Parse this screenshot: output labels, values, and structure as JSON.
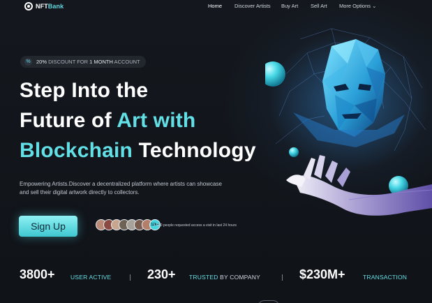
{
  "header": {
    "logo": {
      "text_main": "NFT",
      "text_accent": "Bank"
    },
    "nav": [
      {
        "label": "Home",
        "active": true
      },
      {
        "label": "Discover Artists",
        "active": false
      },
      {
        "label": "Buy Art",
        "active": false
      },
      {
        "label": "Sell Art",
        "active": false
      },
      {
        "label": "More Options ⌄",
        "active": false
      }
    ]
  },
  "hero": {
    "discount": {
      "icon": "percent-icon",
      "prefix": "20% ",
      "mid": "DISCOUNT FOR ",
      "months": "1 MONTH",
      "suffix": " ACCOUNT"
    },
    "headline": {
      "line1": "Step Into the",
      "line2_plain": "Future of ",
      "line2_accent": "Art with",
      "line3_accent": "Blockchain",
      "line3_plain": " Technology"
    },
    "description": "Empowering Artists.Discover a decentralized platform where artists can showcase and sell their digital artwork directly to collectors.",
    "signup_label": "Sign Up",
    "avatars_more": "12k+",
    "requests_text": "1.600 people requested access a visit in last 24 hours"
  },
  "stats": [
    {
      "value": "3800+",
      "label_accent": "USER ACTIVE",
      "label_plain": ""
    },
    {
      "value": "230+",
      "label_accent": "TRUSTED ",
      "label_plain": "BY COMPANY"
    },
    {
      "value": "$230M+",
      "label_accent": "TRANSACTION",
      "label_plain": ""
    }
  ],
  "colors": {
    "background": "#111419",
    "accent": "#63dfe6",
    "button": "#5cd6de"
  }
}
